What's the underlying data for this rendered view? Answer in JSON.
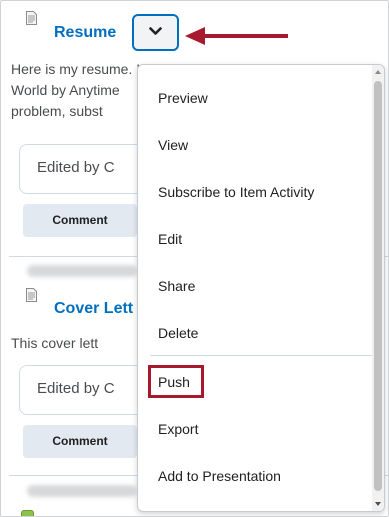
{
  "entries": [
    {
      "title": "Resume",
      "description": [
        "Here is my resume. I didn't include the three ye",
        "World by Anytime",
        "problem, subst"
      ],
      "edited": "Edited by C",
      "comment_label": "Comment"
    },
    {
      "title": "Cover Lett",
      "description": [
        "This cover lett"
      ],
      "edited": "Edited by C",
      "comment_label": "Comment"
    }
  ],
  "menu": {
    "items": [
      "Preview",
      "View",
      "Subscribe to Item Activity",
      "Edit",
      "Share",
      "Delete",
      "Push",
      "Export",
      "Add to Presentation"
    ],
    "highlighted_item": "Push"
  },
  "colors": {
    "link": "#006fbf",
    "annotation": "#a6192e",
    "button_bg": "#e3e9f1"
  },
  "icons": {
    "document": "document-icon",
    "chevron": "chevron-down-icon",
    "arrow": "arrow-left-icon"
  }
}
